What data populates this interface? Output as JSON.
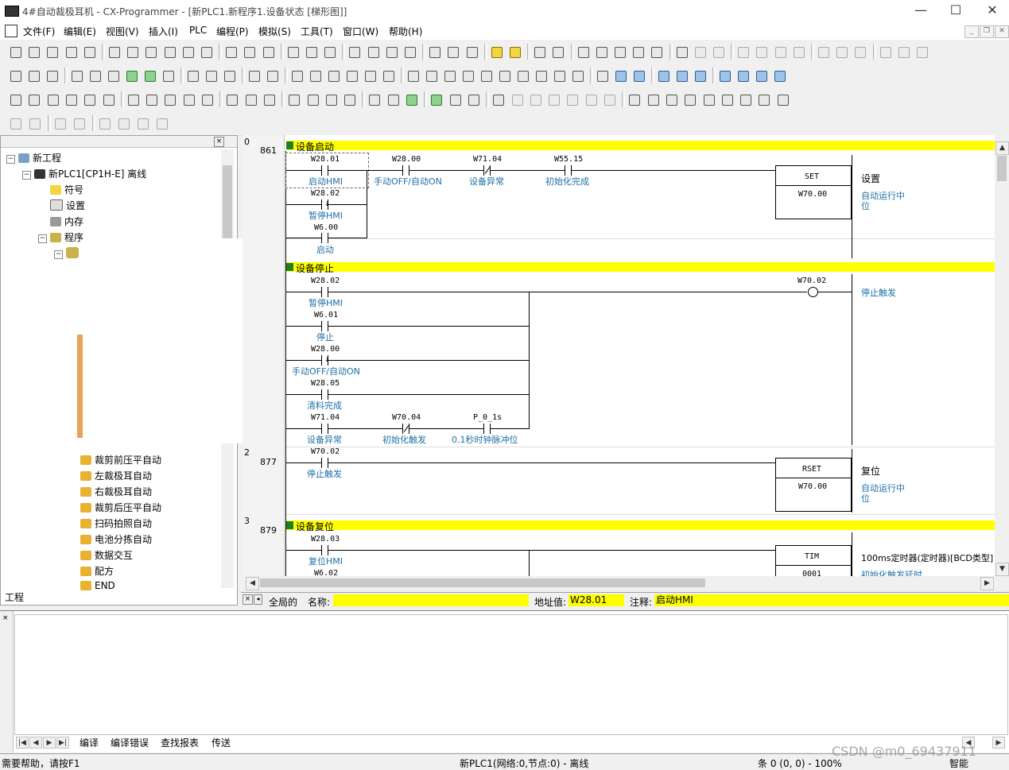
{
  "window": {
    "title": "4#自动裁极耳机 - CX-Programmer - [新PLC1.新程序1.设备状态 [梯形图]]",
    "minimize": "—",
    "maximize": "☐",
    "close": "✕"
  },
  "menu": [
    "文件(F)",
    "编辑(E)",
    "视图(V)",
    "插入(I)",
    "PLC",
    "编程(P)",
    "模拟(S)",
    "工具(T)",
    "窗口(W)",
    "帮助(H)"
  ],
  "mdi_buttons": [
    "_",
    "❐",
    "✕"
  ],
  "tree": {
    "root": "新工程",
    "plc": "新PLC1[CP1H-E] 离线",
    "items": [
      "符号",
      "设置",
      "内存",
      "程序"
    ],
    "sections": [
      "裁剪前压平自动",
      "左裁极耳自动",
      "右裁极耳自动",
      "裁剪后压平自动",
      "扫码拍照自动",
      "电池分拣自动",
      "数据交互",
      "配方",
      "END"
    ],
    "tab": "工程"
  },
  "ladder": {
    "rung0": {
      "no": "0",
      "step": "861",
      "banner": "设备启动"
    },
    "rung1": {
      "banner": "设备停止"
    },
    "rung2": {
      "no": "2",
      "step": "877"
    },
    "rung3": {
      "no": "3",
      "step": "879",
      "banner": "设备复位"
    },
    "r0": {
      "c1_addr": "W28.01",
      "c1_cmt": "启动HMI",
      "c2_addr": "W28.00",
      "c2_cmt": "手动OFF/自动ON",
      "c3_addr": "W71.04",
      "c3_cmt": "设备异常",
      "c4_addr": "W55.15",
      "c4_cmt": "初始化完成",
      "p1_addr": "W28.02",
      "p1_cmt": "暂停HMI",
      "p2_addr": "W6.00",
      "p2_cmt": "启动",
      "instr": "SET",
      "operand": "W70.00",
      "note1": "设置",
      "note2": "自动运行中",
      "note3": "位"
    },
    "r1": {
      "c1_addr": "W28.02",
      "c1_cmt": "暂停HMI",
      "c2_addr": "W6.01",
      "c2_cmt": "停止",
      "c3_addr": "W28.00",
      "c3_cmt": "手动OFF/自动ON",
      "c4_addr": "W28.05",
      "c4_cmt": "清料完成",
      "c5_addr": "W71.04",
      "c5_cmt": "设备异常",
      "c6_addr": "W70.04",
      "c6_cmt": "初始化触发",
      "c7_addr": "P_0_1s",
      "c7_cmt": "0.1秒时钟脉冲位",
      "coil_addr": "W70.02",
      "coil_cmt": "停止触发"
    },
    "r2": {
      "c1_addr": "W70.02",
      "c1_cmt": "停止触发",
      "instr": "RSET",
      "operand": "W70.00",
      "note1": "复位",
      "note2": "自动运行中",
      "note3": "位"
    },
    "r3": {
      "c1_addr": "W28.03",
      "c1_cmt": "复位HMI",
      "c2_addr": "W6.02",
      "instr": "TIM",
      "operand": "0001",
      "note1": "100ms定时器(定时器)[BCD类型]",
      "note2": "初始化触发延时"
    }
  },
  "infobar": {
    "scope": "全局的",
    "name_label": "名称:",
    "name_value": "",
    "addr_label": "地址值:",
    "addr_value": "W28.01",
    "cmt_label": "注释:",
    "cmt_value": "启动HMI"
  },
  "output_tabs": [
    "编译",
    "编译错误",
    "查找报表",
    "传送"
  ],
  "status": {
    "help": "需要帮助，请按F1",
    "plc": "新PLC1(网络:0,节点:0) - 离线",
    "pos": "条 0 (0, 0)  - 100%",
    "mode": "智能"
  },
  "watermark": "CSDN @m0_69437911",
  "colors": {
    "highlight": "#ffff00",
    "comment": "#1e6fa8",
    "rung_marker": "#208020"
  }
}
